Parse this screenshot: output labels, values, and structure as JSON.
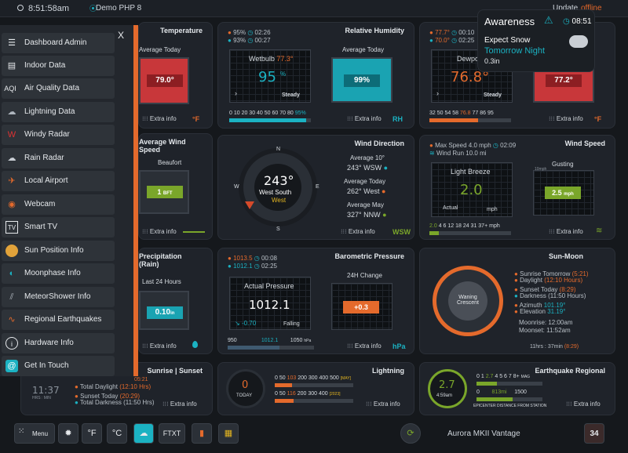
{
  "topbar": {
    "time": "8:51:58am",
    "station": "Demo PHP 8",
    "update": "Update",
    "offline": "offline"
  },
  "sidebar": {
    "close": "X",
    "items": [
      {
        "label": "Dashboard Admin",
        "icon": "admin-icon"
      },
      {
        "label": "Indoor Data",
        "icon": "indoor-icon"
      },
      {
        "label": "Air Quality Data",
        "icon": "aqi-icon",
        "glyph": "AQI"
      },
      {
        "label": "Lightning Data",
        "icon": "lightning-icon"
      },
      {
        "label": "Windy Radar",
        "icon": "windy-icon"
      },
      {
        "label": "Rain Radar",
        "icon": "rain-radar-icon"
      },
      {
        "label": "Local Airport",
        "icon": "airplane-icon"
      },
      {
        "label": "Webcam",
        "icon": "webcam-icon"
      },
      {
        "label": "Smart TV",
        "icon": "tv-icon",
        "glyph": "TV"
      },
      {
        "label": "Sun Position Info",
        "icon": "sun-position-icon"
      },
      {
        "label": "Moonphase Info",
        "icon": "moonphase-icon"
      },
      {
        "label": "MeteorShower Info",
        "icon": "meteor-icon"
      },
      {
        "label": "Regional Earthquakes",
        "icon": "earthquake-icon"
      },
      {
        "label": "Hardware Info",
        "icon": "info-icon",
        "glyph": "i"
      },
      {
        "label": "Get In Touch",
        "icon": "contact-icon",
        "glyph": "@"
      }
    ]
  },
  "awareness": {
    "title": "Awareness",
    "time": "08:51",
    "line1": "Expect Snow",
    "line2": "Tomorrow Night",
    "amount": "0.3in"
  },
  "temperature": {
    "title": "Temperature",
    "avg_label": "Average Today",
    "value": "79.0°",
    "extra": "Extra info",
    "unit": "°F"
  },
  "humidity": {
    "title": "Relative Humidity",
    "max": "95%",
    "max_time": "02:26",
    "min": "93%",
    "min_time": "00:27",
    "wetbulb_label": "Wetbulb",
    "wetbulb_value": "77.3°",
    "value": "95",
    "pct": "%",
    "trend": "Steady",
    "avg_label": "Average Today",
    "avg_value": "99%",
    "scale": "0 10 20 30 40 50 60 70 80",
    "scale_hi": "95%",
    "extra": "Extra info",
    "unit": "RH"
  },
  "dewpoint": {
    "max": "77.7°",
    "max_time": "00:10",
    "min": "70.0°",
    "min_time": "02:25",
    "label": "Dewpo",
    "value": "76.8°",
    "trend": "Steady",
    "avg_value": "77.2°",
    "scale": "32 50 54 58",
    "scale_hi": "76.8",
    "scale_tail": "77 86 95",
    "extra": "Extra info",
    "unit": "°F"
  },
  "avgwind": {
    "title": "Average Wind Speed",
    "label": "Beaufort",
    "value": "1",
    "unit": "BFT",
    "extra": "Extra info"
  },
  "winddir": {
    "title": "Wind Direction",
    "deg": "243°",
    "dir": "West South",
    "dir2": "West",
    "avg10_label": "Average 10°",
    "avg10": "243°",
    "avg10_dir": "WSW",
    "today_label": "Average Today",
    "today": "262°",
    "today_dir": "West",
    "may_label": "Average May",
    "may": "327°",
    "may_dir": "NNW",
    "extra": "Extra info",
    "unit": "WSW",
    "compass": [
      "N",
      "NE",
      "E",
      "SE",
      "S",
      "SW",
      "W",
      "NW"
    ],
    "ticks": [
      "0°",
      "45°",
      "90°",
      "135°",
      "180°",
      "225°",
      "270°",
      "315°"
    ]
  },
  "windspeed": {
    "title": "Wind Speed",
    "max_label": "Max Speed",
    "max": "4.0",
    "max_unit": "mph",
    "max_time": "02:09",
    "run_label": "Wind Run",
    "run": "10.0",
    "run_unit": "mi",
    "desc": "Light Breeze",
    "value": "2.0",
    "actual": "Actual",
    "unit": "mph",
    "gust_label": "Gusting",
    "gust": "2.5",
    "gust_unit": "mph",
    "scale_hi": "2.0",
    "scale": "4 6 12 18 24 31 37+",
    "scale_unit": "mph",
    "extra": "Extra info",
    "side_scale": "10mph"
  },
  "precip": {
    "title": "Precipitation (Rain)",
    "label": "Last 24 Hours",
    "value": "0.10",
    "unit": "in",
    "extra": "Extra info"
  },
  "baro": {
    "title": "Barometric Pressure",
    "max": "1013.5",
    "max_time": "00:08",
    "min": "1012.1",
    "min_time": "02:25",
    "label": "Actual Pressure",
    "value": "1012.1",
    "change": "-0.70",
    "trend": "Falling",
    "h24_label": "24H Change",
    "h24": "+0.3",
    "scale_lo": "950",
    "scale_mid": "1012.1",
    "scale_hi": "1050",
    "scale_unit": "hPa",
    "axis": [
      "+10",
      "+6",
      "+2",
      "-2",
      "-6",
      "-10"
    ],
    "extra": "Extra info",
    "unit": "hPa"
  },
  "sunmoon": {
    "title": "Sun-Moon",
    "phase": "Waning Crescent",
    "sunrise_label": "Sunrise Tomorrow",
    "sunrise": "(5:21)",
    "daylight_label": "Daylight",
    "daylight": "(12:10 Hours)",
    "sunset_label": "Sunset Today",
    "sunset": "(8:29)",
    "darkness_label": "Darkness",
    "darkness": "(11:50 Hours)",
    "azimuth_label": "Azimuth",
    "azimuth": "101.19°",
    "elevation_label": "Elevation",
    "elevation": "31.19°",
    "moonrise_label": "Moonrise:",
    "moonrise": "12:00am",
    "moonset_label": "Moonset:",
    "moonset": "11:52am",
    "hrs": "11hrs : 37min",
    "hrs_hi": "(8:29)"
  },
  "sunrise": {
    "title": "Sunrise | Sunset",
    "clock": "11:37",
    "clock_sub": "HRS : MIN",
    "top_val": "05:21",
    "daylight_label": "Total Daylight",
    "daylight": "(12:10 Hrs)",
    "sunset_label": "Sunset Today",
    "sunset": "(20:29)",
    "darkness_label": "Total Darkness",
    "darkness": "(11:50 Hrs)",
    "extra": "Extra info"
  },
  "lightning": {
    "title": "Lightning",
    "value": "0",
    "today": "TODAY",
    "scale1": "0 50",
    "scale1_hi": "103",
    "scale1_tail": "200 300 400 500",
    "scale1_tag": "[MAY]",
    "scale2": "0 50",
    "scale2_hi": "116",
    "scale2_tail": "200 300 400",
    "scale2_tag": "[2023]",
    "extra": "Extra info"
  },
  "quake": {
    "title": "Earthquake Regional",
    "mag": "2.7",
    "time": "4:59am",
    "scale": "0 1",
    "scale_hi": "2.7",
    "scale_tail": "4 5 6 7 8+",
    "scale_tag": "MAG",
    "dist_lo": "0",
    "dist": "813mi",
    "dist_hi": "1500",
    "dist_label": "EPICENTER DISTANCE FROM STATION",
    "extra": "Extra info"
  },
  "bottom": {
    "menu": "Menu",
    "f": "°F",
    "c": "°C",
    "ftxt": "FTXT",
    "brand": "Aurora MKII Vantage",
    "cal": "34"
  },
  "colors": {
    "accent": "#e46a2c",
    "teal": "#1bb2c2",
    "red": "#c8373a",
    "green": "#7aa62a"
  }
}
